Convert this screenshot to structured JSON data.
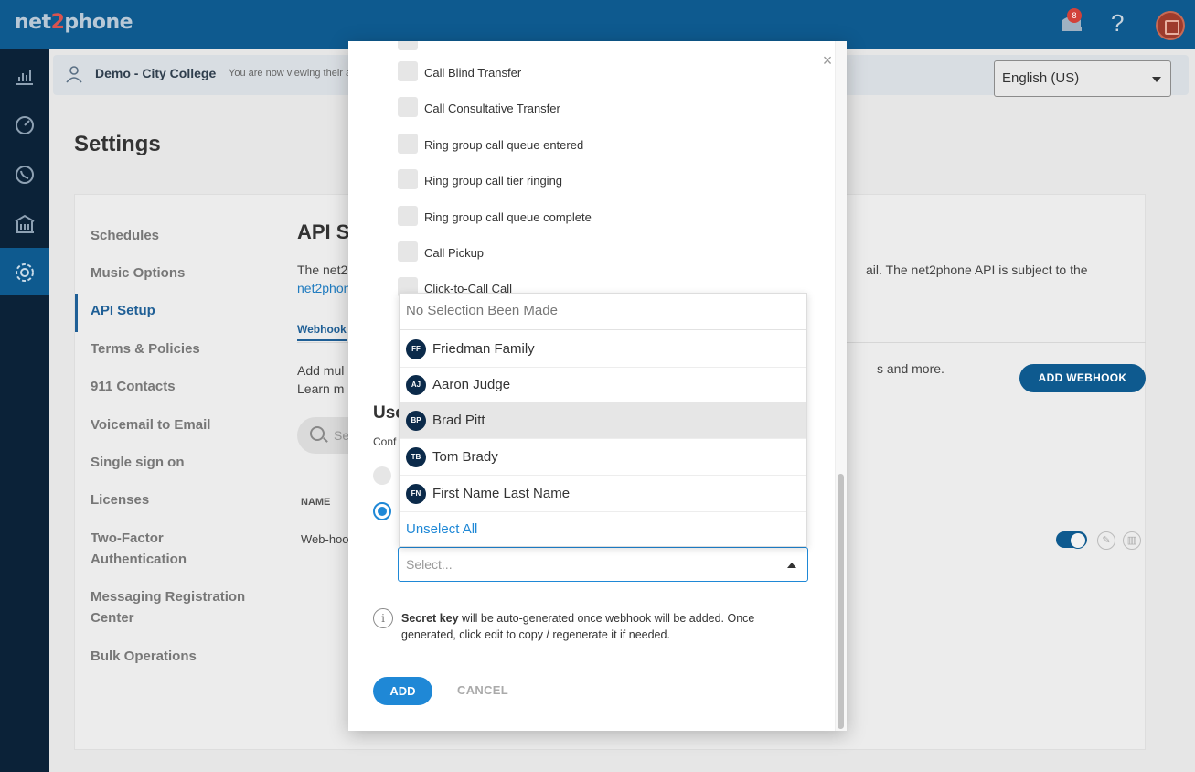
{
  "app": {
    "logo_pre": "net",
    "logo_mid": "2",
    "logo_post": "phone",
    "notification_count": "8",
    "help_glyph": "?"
  },
  "org_bar": {
    "name": "Demo - City College",
    "note": "You are now viewing their a",
    "language": "English (US)"
  },
  "page": {
    "title": "Settings"
  },
  "settings_menu": [
    "Schedules",
    "Music Options",
    "API Setup",
    "Terms & Policies",
    "911 Contacts",
    "Voicemail to Email",
    "Single sign on",
    "Licenses",
    "Two-Factor Authentication",
    "Messaging Registration Center",
    "Bulk Operations"
  ],
  "api": {
    "title": "API S",
    "desc_left": "The net2",
    "desc_link": "net2phon",
    "desc_right": "ail. The net2phone API is subject to the",
    "tab": "Webhook",
    "add_desc_1": "Add mul",
    "add_desc_2": "Learn m",
    "add_desc_right": "s and more.",
    "add_button": "ADD WEBHOOK",
    "search_placeholder": "Se",
    "column_name": "NAME",
    "row_name": "Web-hoo"
  },
  "modal": {
    "close_glyph": "×",
    "events": [
      "Call Blind Transfer",
      "Call Consultative Transfer",
      "Ring group call queue entered",
      "Ring group call tier ringing",
      "Ring group call queue complete",
      "Call Pickup",
      "Click-to-Call Call"
    ],
    "users_title": "Use",
    "users_subtitle": "Conf",
    "select_placeholder": "Select...",
    "info_bold": "Secret key",
    "info_text": " will be auto-generated once webhook will be added. Once generated, click edit to copy / regenerate it if needed.",
    "add_button": "ADD",
    "cancel_button": "CANCEL"
  },
  "dropdown": {
    "header": "No Selection Been Made",
    "options": [
      {
        "initials": "FF",
        "name": "Friedman Family"
      },
      {
        "initials": "AJ",
        "name": "Aaron Judge"
      },
      {
        "initials": "BP",
        "name": "Brad Pitt"
      },
      {
        "initials": "TB",
        "name": "Tom Brady"
      },
      {
        "initials": "FN",
        "name": "First Name Last Name"
      }
    ],
    "highlighted_index": 2,
    "unselect_all": "Unselect All"
  },
  "colors": {
    "topbar": "#0e5a8f",
    "leftnav": "#0b2238",
    "accent": "#1f88d6"
  }
}
